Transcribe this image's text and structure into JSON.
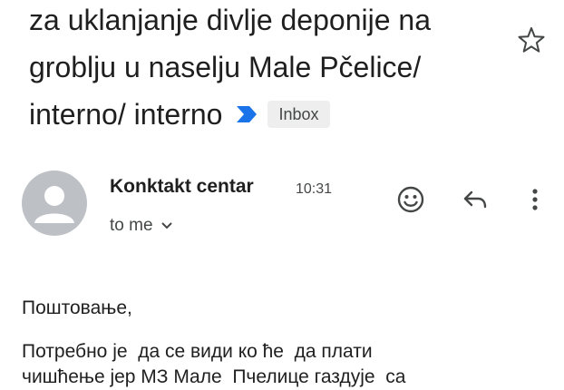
{
  "email": {
    "subject_lines": [
      "za uklanjanje divlje deponije na",
      "groblju u naselju Male Pčelice/",
      "interno/ interno"
    ],
    "label": "Inbox",
    "sender": "Konktakt centar",
    "time": "10:31",
    "recipient": "to me",
    "body": {
      "greeting": "Поштовање,",
      "paragraph_lines": [
        "Потребно је  да се види ко ће  да плати",
        "чишћење јер МЗ Мале  Пчелице газдује  са"
      ]
    }
  },
  "icons": {
    "star": "star-outline-icon",
    "importance": "importance-marker-icon",
    "emoji": "emoji-reaction-icon",
    "reply": "reply-icon",
    "more": "more-vert-icon",
    "avatar": "person-avatar-icon",
    "dropdown": "chevron-down-icon"
  },
  "colors": {
    "importance_marker": "#1a73e8",
    "label_bg": "#eeeeee",
    "avatar_bg": "#bdc1c6",
    "icon": "#444746"
  }
}
